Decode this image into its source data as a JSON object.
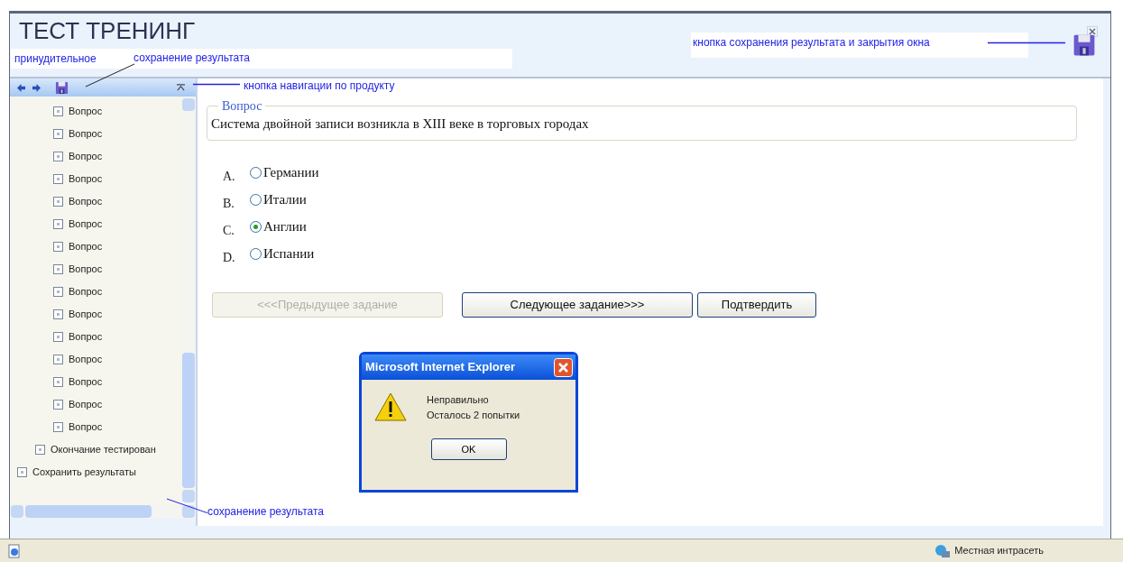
{
  "header": {
    "title": "ТЕСТ ТРЕНИНГ"
  },
  "annotations": [
    {
      "text": "принудительное"
    },
    {
      "text": "сохранение результата"
    },
    {
      "text": "кнопка навигации по продукту"
    },
    {
      "text": "кнопка сохранения результата и закрытия окна"
    },
    {
      "text": "сохранение результата"
    }
  ],
  "tree": [
    {
      "children": [
        {
          "children": [
            {
              "label": "Вопрос"
            },
            {
              "label": "Вопрос"
            },
            {
              "label": "Вопрос"
            },
            {
              "label": "Вопрос"
            },
            {
              "label": "Вопрос"
            },
            {
              "label": "Вопрос"
            },
            {
              "label": "Вопрос"
            },
            {
              "label": "Вопрос"
            },
            {
              "label": "Вопрос"
            },
            {
              "label": "Вопрос"
            },
            {
              "label": "Вопрос"
            },
            {
              "label": "Вопрос"
            },
            {
              "label": "Вопрос"
            },
            {
              "label": "Вопрос"
            },
            {
              "label": "Вопрос"
            }
          ]
        },
        {
          "label": "Окончание тестирован"
        }
      ]
    },
    {
      "label": "Сохранить результаты"
    }
  ],
  "question": {
    "legend": "Вопрос",
    "text": "Система двойной записи возникла в XIII веке в торговых городах"
  },
  "options": [
    {
      "letter": "A.",
      "label": "Германии",
      "selected": false
    },
    {
      "letter": "B.",
      "label": "Италии",
      "selected": false
    },
    {
      "letter": "C.",
      "label": "Англии",
      "selected": true
    },
    {
      "letter": "D.",
      "label": "Испании",
      "selected": false
    }
  ],
  "buttons": [
    {
      "label": "<<<Предыдущее задание",
      "disabled": true
    },
    {
      "label": "Следующее задание>>>",
      "disabled": false
    },
    {
      "label": "Подтвердить",
      "disabled": false
    }
  ],
  "dialog": {
    "title": "Microsoft Internet Explorer",
    "lines": [
      "Неправильно",
      "Осталось 2 попытки"
    ],
    "button": "OK"
  },
  "status_bar": {
    "zone": "Местная интрасеть"
  }
}
